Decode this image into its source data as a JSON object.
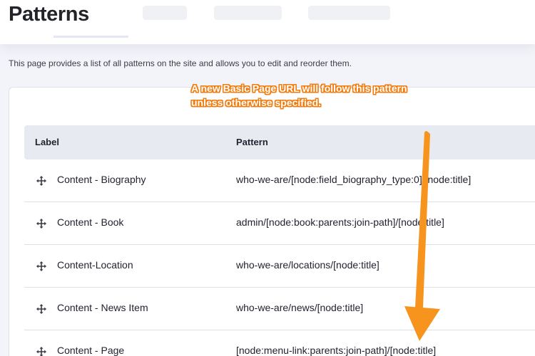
{
  "page": {
    "title": "Patterns",
    "description": "This page provides a list of all patterns on the site and allows you to edit and reorder them."
  },
  "annotation": {
    "line1": "A new Basic Page URL will follow this pattern",
    "line2": "unless otherwise specified.",
    "color": "#f7941d"
  },
  "table": {
    "headers": {
      "label": "Label",
      "pattern": "Pattern"
    },
    "rows": [
      {
        "label": "Content - Biography",
        "pattern": "who-we-are/[node:field_biography_type:0]/[node:title]"
      },
      {
        "label": "Content - Book",
        "pattern": "admin/[node:book:parents:join-path]/[node:title]"
      },
      {
        "label": "Content-Location",
        "pattern": "who-we-are/locations/[node:title]"
      },
      {
        "label": "Content - News Item",
        "pattern": "who-we-are/news/[node:title]"
      },
      {
        "label": "Content - Page",
        "pattern": "[node:menu-link:parents:join-path]/[node:title]"
      }
    ]
  },
  "icons": {
    "drag": "move-arrows-icon"
  }
}
